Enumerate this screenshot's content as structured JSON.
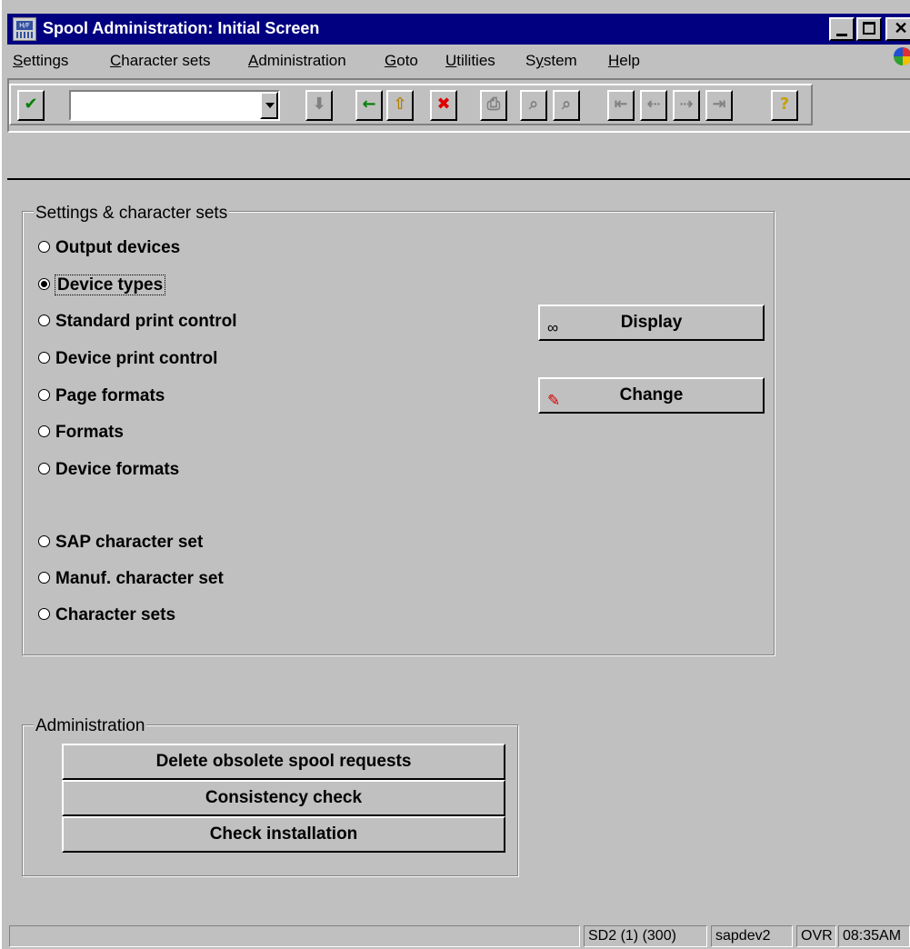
{
  "window": {
    "title": "Spool Administration: Initial Screen",
    "app_icon_text": "H/F"
  },
  "menu": {
    "items": [
      {
        "label": "Settings",
        "accel": "S",
        "rest": "ettings"
      },
      {
        "label": "Character sets",
        "accel": "C",
        "rest": "haracter sets"
      },
      {
        "label": "Administration",
        "accel": "A",
        "rest": "dministration"
      },
      {
        "label": "Goto",
        "accel": "G",
        "rest": "oto"
      },
      {
        "label": "Utilities",
        "accel": "U",
        "rest": "tilities"
      },
      {
        "label": "System",
        "accel": "y",
        "pre": "S",
        "rest": "stem"
      },
      {
        "label": "Help",
        "accel": "H",
        "rest": "elp"
      }
    ]
  },
  "toolbar": {
    "command_value": "",
    "icons": {
      "enter": "✔",
      "save": "⬇",
      "back": "←",
      "exit": "⇧",
      "cancel": "✖",
      "print": "⎙",
      "find": "⌕",
      "find_next": "⌕",
      "first_page": "⇤",
      "prev_page": "⇠",
      "next_page": "⇢",
      "last_page": "⇥",
      "help": "?"
    },
    "colors": {
      "enter": "#008000",
      "back": "#008000",
      "exit": "#b08000",
      "cancel": "#e00000",
      "help": "#c8a000"
    }
  },
  "settings_group": {
    "title": "Settings & character sets",
    "options": [
      {
        "label": "Output devices",
        "selected": false
      },
      {
        "label": "Device types",
        "selected": true
      },
      {
        "label": "Standard print control",
        "selected": false
      },
      {
        "label": "Device print control",
        "selected": false
      },
      {
        "label": "Page formats",
        "selected": false
      },
      {
        "label": "Formats",
        "selected": false
      },
      {
        "label": "Device formats",
        "selected": false
      },
      {
        "label": "SAP character set",
        "selected": false
      },
      {
        "label": "Manuf. character set",
        "selected": false
      },
      {
        "label": "Character sets",
        "selected": false
      }
    ],
    "display_button": "Display",
    "change_button": "Change",
    "display_icon": "∞",
    "change_icon": "✎"
  },
  "admin_group": {
    "title": "Administration",
    "buttons": [
      "Delete obsolete spool requests",
      "Consistency check",
      "Check installation"
    ]
  },
  "status": {
    "system": "SD2 (1) (300)",
    "server": "sapdev2",
    "mode": "OVR",
    "time": "08:35AM"
  }
}
